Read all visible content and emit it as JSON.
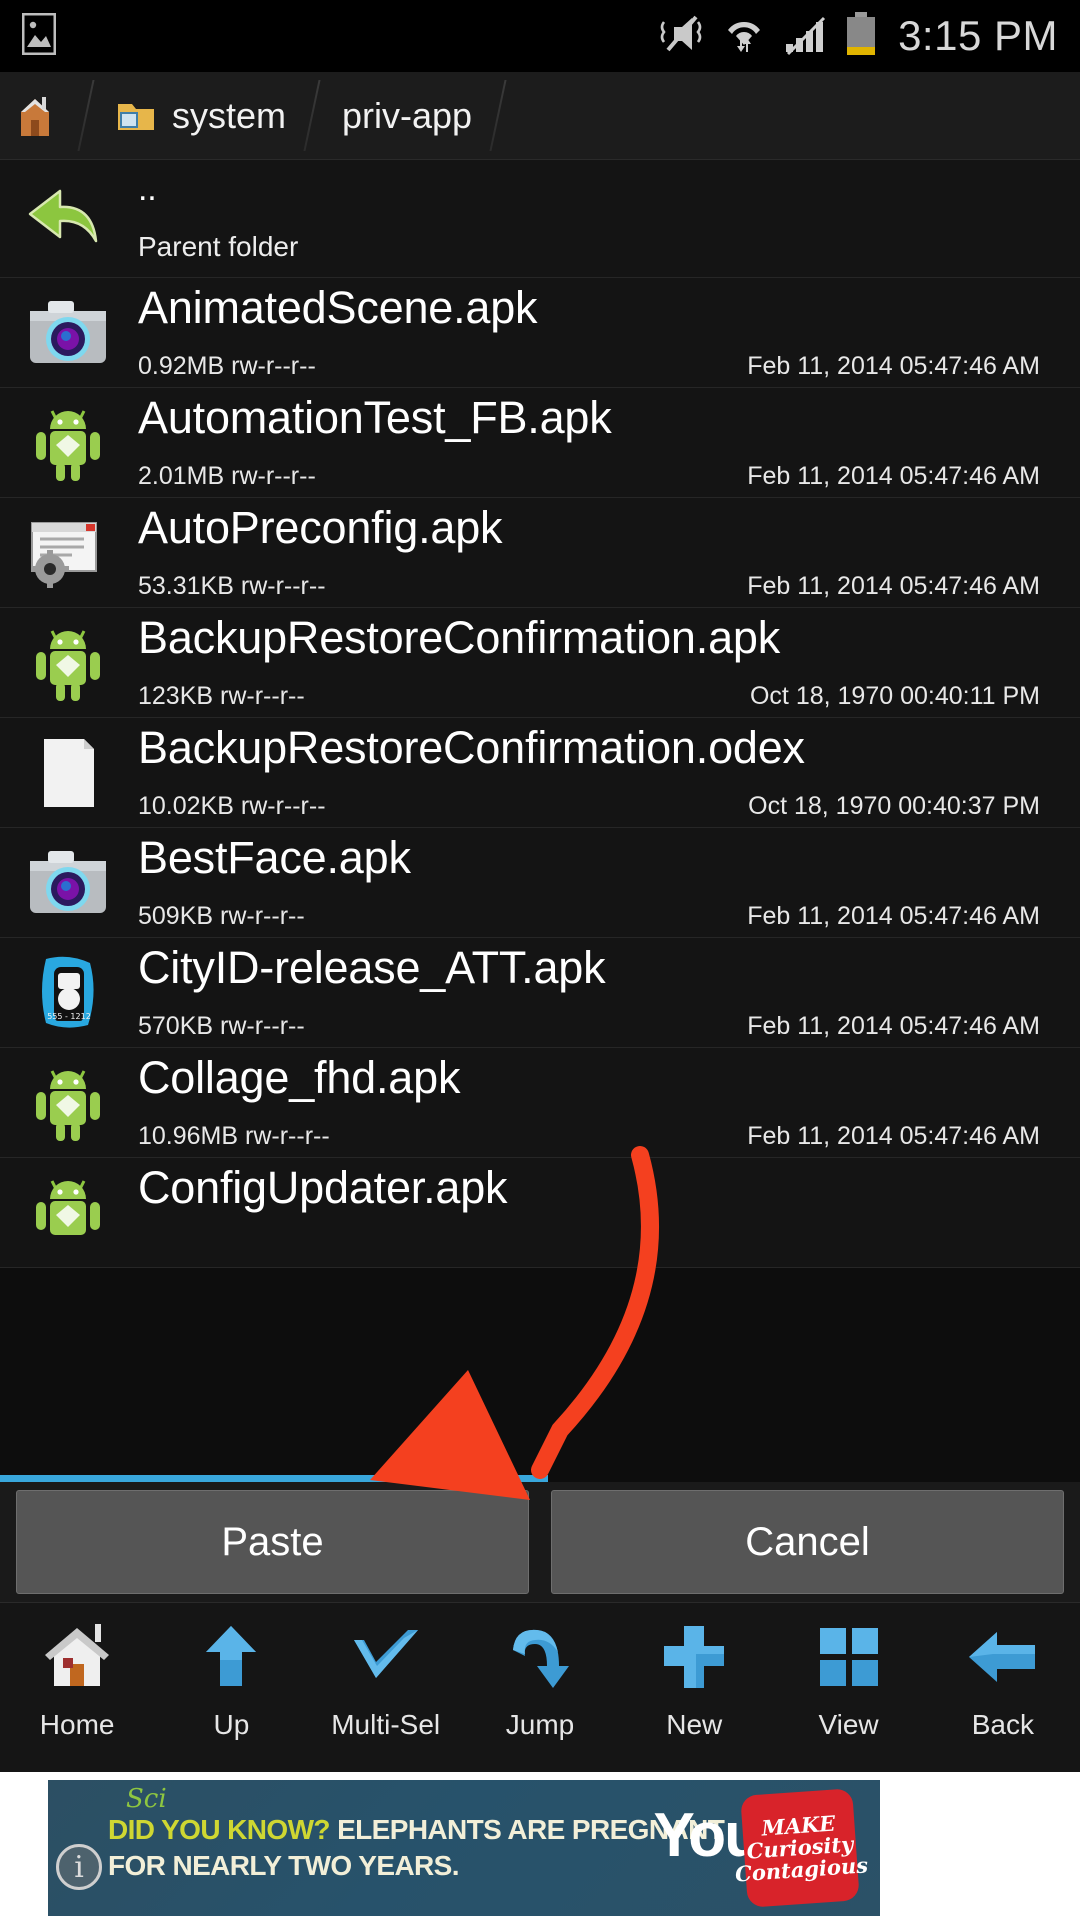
{
  "status_bar": {
    "clock": "3:15 PM",
    "icons": [
      "image-icon",
      "mute-vibrate-icon",
      "wifi-icon",
      "signal-icon",
      "battery-icon"
    ]
  },
  "breadcrumb": {
    "items": [
      {
        "label": "",
        "icon": "home-icon"
      },
      {
        "label": "system",
        "icon": "folder-icon"
      },
      {
        "label": "priv-app",
        "icon": ""
      }
    ]
  },
  "file_list": {
    "parent": {
      "name": "..",
      "subtitle": "Parent folder",
      "icon": "back-arrow-icon"
    },
    "rows": [
      {
        "name": "AnimatedScene.apk",
        "size": "0.92MB",
        "perms": "rw-r--r--",
        "date": "Feb 11, 2014 05:47:46 AM",
        "icon": "camera-icon"
      },
      {
        "name": "AutomationTest_FB.apk",
        "size": "2.01MB",
        "perms": "rw-r--r--",
        "date": "Feb 11, 2014 05:47:46 AM",
        "icon": "android-icon"
      },
      {
        "name": "AutoPreconfig.apk",
        "size": "53.31KB",
        "perms": "rw-r--r--",
        "date": "Feb 11, 2014 05:47:46 AM",
        "icon": "config-icon"
      },
      {
        "name": "BackupRestoreConfirmation.apk",
        "size": "123KB",
        "perms": "rw-r--r--",
        "date": "Oct 18, 1970 00:40:11 PM",
        "icon": "android-icon"
      },
      {
        "name": "BackupRestoreConfirmation.odex",
        "size": "10.02KB",
        "perms": "rw-r--r--",
        "date": "Oct 18, 1970 00:40:37 PM",
        "icon": "file-icon"
      },
      {
        "name": "BestFace.apk",
        "size": "509KB",
        "perms": "rw-r--r--",
        "date": "Feb 11, 2014 05:47:46 AM",
        "icon": "camera-icon"
      },
      {
        "name": "CityID-release_ATT.apk",
        "size": "570KB",
        "perms": "rw-r--r--",
        "date": "Feb 11, 2014 05:47:46 AM",
        "icon": "cityid-icon"
      },
      {
        "name": "Collage_fhd.apk",
        "size": "10.96MB",
        "perms": "rw-r--r--",
        "date": "Feb 11, 2014 05:47:46 AM",
        "icon": "android-icon"
      },
      {
        "name": "ConfigUpdater.apk",
        "size": "",
        "perms": "",
        "date": "",
        "icon": "android-icon"
      }
    ]
  },
  "actions": {
    "paste_label": "Paste",
    "cancel_label": "Cancel"
  },
  "toolbar": {
    "items": [
      {
        "label": "Home",
        "icon": "house-icon"
      },
      {
        "label": "Up",
        "icon": "up-arrow-icon"
      },
      {
        "label": "Multi-Sel",
        "icon": "checkmark-icon"
      },
      {
        "label": "Jump",
        "icon": "jump-arrow-icon"
      },
      {
        "label": "New",
        "icon": "plus-icon"
      },
      {
        "label": "View",
        "icon": "grid-icon"
      },
      {
        "label": "Back",
        "icon": "left-arrow-icon"
      }
    ]
  },
  "ad": {
    "brand": "Sci",
    "line1_highlight": "DID YOU KNOW?",
    "line1_rest": " ELEPHANTS ARE PREGNANT",
    "line2": "FOR NEARLY TWO YEARS.",
    "logo_text": "You",
    "badge_lines": [
      "MAKE",
      "Curiosity",
      "Contagious"
    ],
    "info_glyph": "i"
  },
  "colors": {
    "accent_blue": "#39a7dc",
    "arrow_red": "#f4401f",
    "button_gray": "#555555",
    "row_bg": "#141414"
  }
}
